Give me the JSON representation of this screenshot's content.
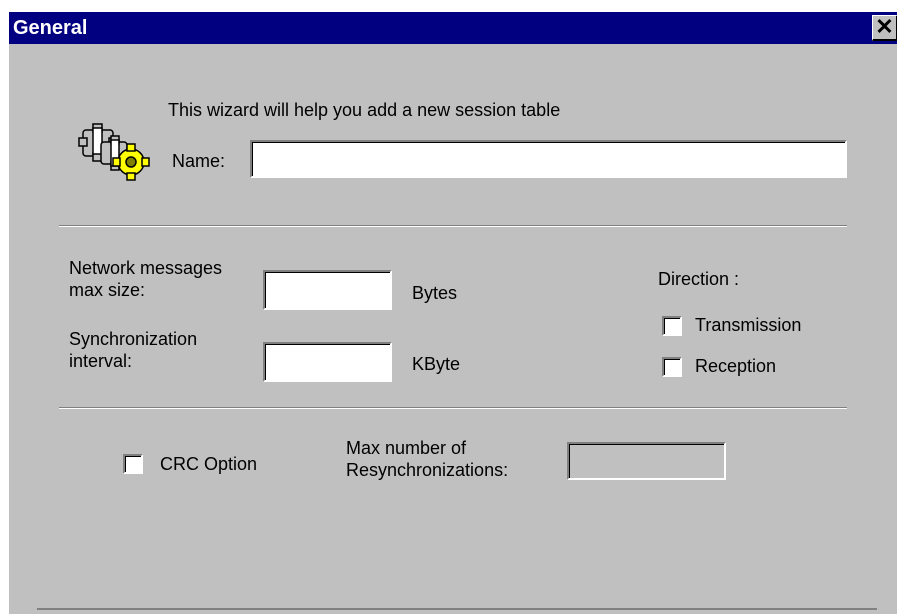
{
  "window": {
    "title": "General",
    "close_symbol": "✕"
  },
  "intro": {
    "text": "This wizard will help you add a new session table"
  },
  "name_field": {
    "label": "Name:",
    "value": ""
  },
  "network_messages": {
    "label_line1": "Network messages",
    "label_line2": "max size:",
    "value": "",
    "unit": "Bytes"
  },
  "sync_interval": {
    "label_line1": "Synchronization",
    "label_line2": "interval:",
    "value": "",
    "unit": "KByte"
  },
  "direction": {
    "label": "Direction :",
    "transmission_label": "Transmission",
    "reception_label": "Reception",
    "transmission_checked": false,
    "reception_checked": false
  },
  "crc": {
    "label": "CRC Option",
    "checked": false
  },
  "resync": {
    "label_line1": "Max number of",
    "label_line2": "Resynchronizations:",
    "value": "",
    "disabled": true
  },
  "colors": {
    "titlebar": "#000080",
    "dialog_bg": "#c0c0c0",
    "title_text": "#ffffff"
  },
  "icons": {
    "wizard": "gears-icon"
  }
}
